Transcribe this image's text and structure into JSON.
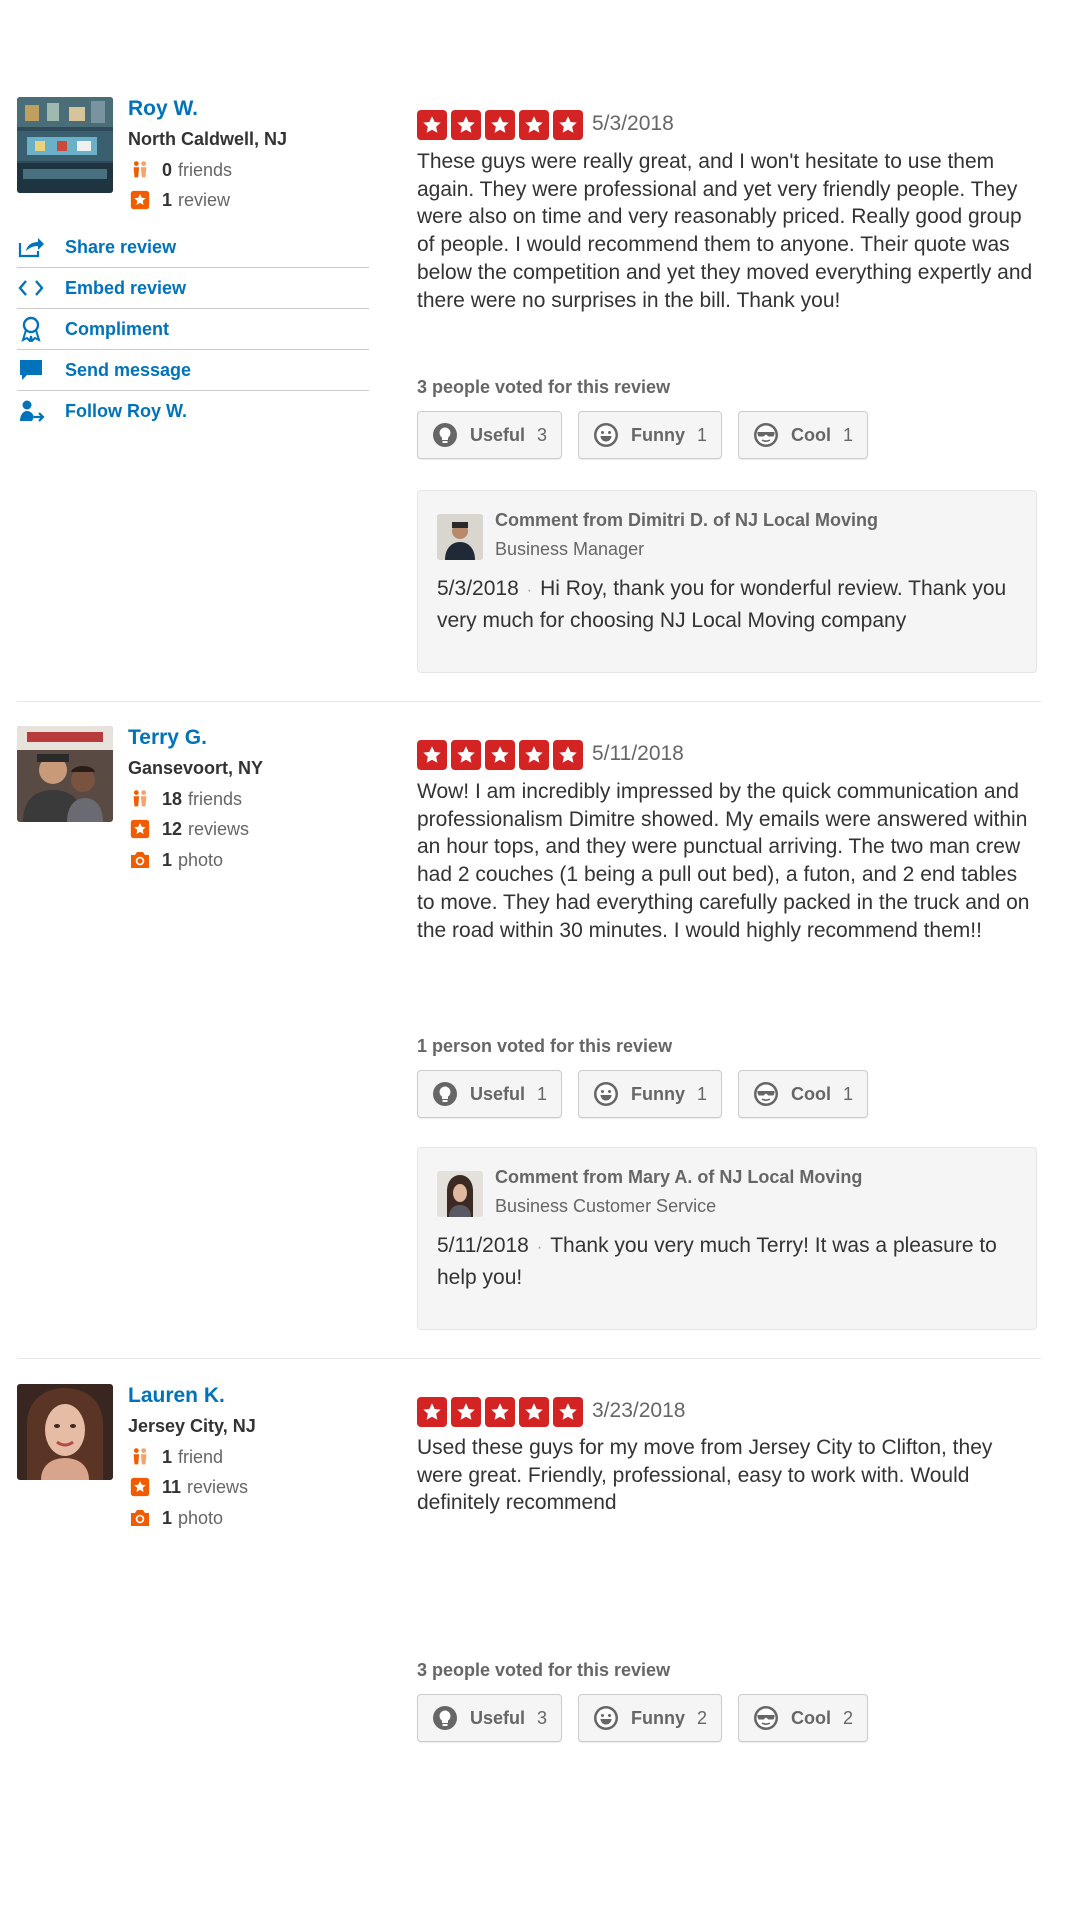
{
  "actions": {
    "share": "Share review",
    "embed": "Embed review",
    "compliment": "Compliment",
    "message": "Send message",
    "follow": "Follow Roy W."
  },
  "vote_labels": {
    "useful": "Useful",
    "funny": "Funny",
    "cool": "Cool"
  },
  "colors": {
    "link": "#0073bb",
    "star": "#d32323",
    "stat_icon": "#f15c00"
  },
  "reviews": [
    {
      "user": {
        "name": "Roy W.",
        "location": "North Caldwell, NJ",
        "friends_count": "0",
        "friends_label": "friends",
        "reviews_count": "1",
        "reviews_label": "review"
      },
      "rating": 5,
      "date": "5/3/2018",
      "text": "These guys were really great, and I won't hesitate to use them again. They were professional and yet very friendly people. They were also on time and very reasonably priced. Really good group of people. I would recommend them to anyone. Their quote was below the competition and yet they moved everything expertly and there were no surprises in the bill. Thank you!",
      "votes_label": "3 people voted for this review",
      "votes": {
        "useful": "3",
        "funny": "1",
        "cool": "1"
      },
      "comment": {
        "from": "Comment from Dimitri D. of NJ Local Moving",
        "role": "Business Manager",
        "date": "5/3/2018",
        "text": "Hi Roy, thank you for wonderful review. Thank you very much for choosing NJ Local Moving company"
      }
    },
    {
      "user": {
        "name": "Terry G.",
        "location": "Gansevoort, NY",
        "friends_count": "18",
        "friends_label": "friends",
        "reviews_count": "12",
        "reviews_label": "reviews",
        "photos_count": "1",
        "photos_label": "photo"
      },
      "rating": 5,
      "date": "5/11/2018",
      "text": "Wow! I am incredibly impressed by the quick communication and professionalism Dimitre showed. My emails were answered within an hour tops, and they were punctual arriving. The two man crew had 2 couches (1 being a pull out bed), a futon, and 2 end tables to move. They had everything  carefully packed in the truck and on the road within 30 minutes. I would highly recommend them!!",
      "votes_label": "1 person voted for this review",
      "votes": {
        "useful": "1",
        "funny": "1",
        "cool": "1"
      },
      "comment": {
        "from": "Comment from Mary A. of NJ Local Moving",
        "role": "Business Customer Service",
        "date": "5/11/2018",
        "text": "Thank you very much Terry! It was a pleasure to help you!"
      }
    },
    {
      "user": {
        "name": "Lauren K.",
        "location": "Jersey City, NJ",
        "friends_count": "1",
        "friends_label": "friend",
        "reviews_count": "11",
        "reviews_label": "reviews",
        "photos_count": "1",
        "photos_label": "photo"
      },
      "rating": 5,
      "date": "3/23/2018",
      "text": "Used these guys for my move from Jersey City to Clifton, they were great. Friendly, professional, easy to work with. Would definitely recommend",
      "votes_label": "3 people voted for this review",
      "votes": {
        "useful": "3",
        "funny": "2",
        "cool": "2"
      }
    }
  ]
}
